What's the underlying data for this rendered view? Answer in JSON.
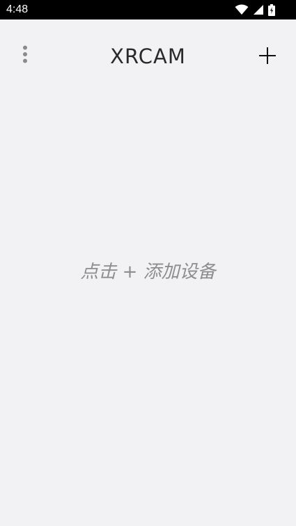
{
  "status_bar": {
    "time": "4:48",
    "icons": [
      "wifi-icon",
      "signal-icon",
      "battery-icon"
    ]
  },
  "header": {
    "title": "XRCAM",
    "menu_icon": "more-vert-icon",
    "add_icon": "plus-icon"
  },
  "main": {
    "empty_hint": "点击 + 添加设备"
  },
  "colors": {
    "background": "#f2f2f4",
    "status_bar": "#000000",
    "title": "#2a2a2a",
    "hint": "#8d8d8f"
  }
}
